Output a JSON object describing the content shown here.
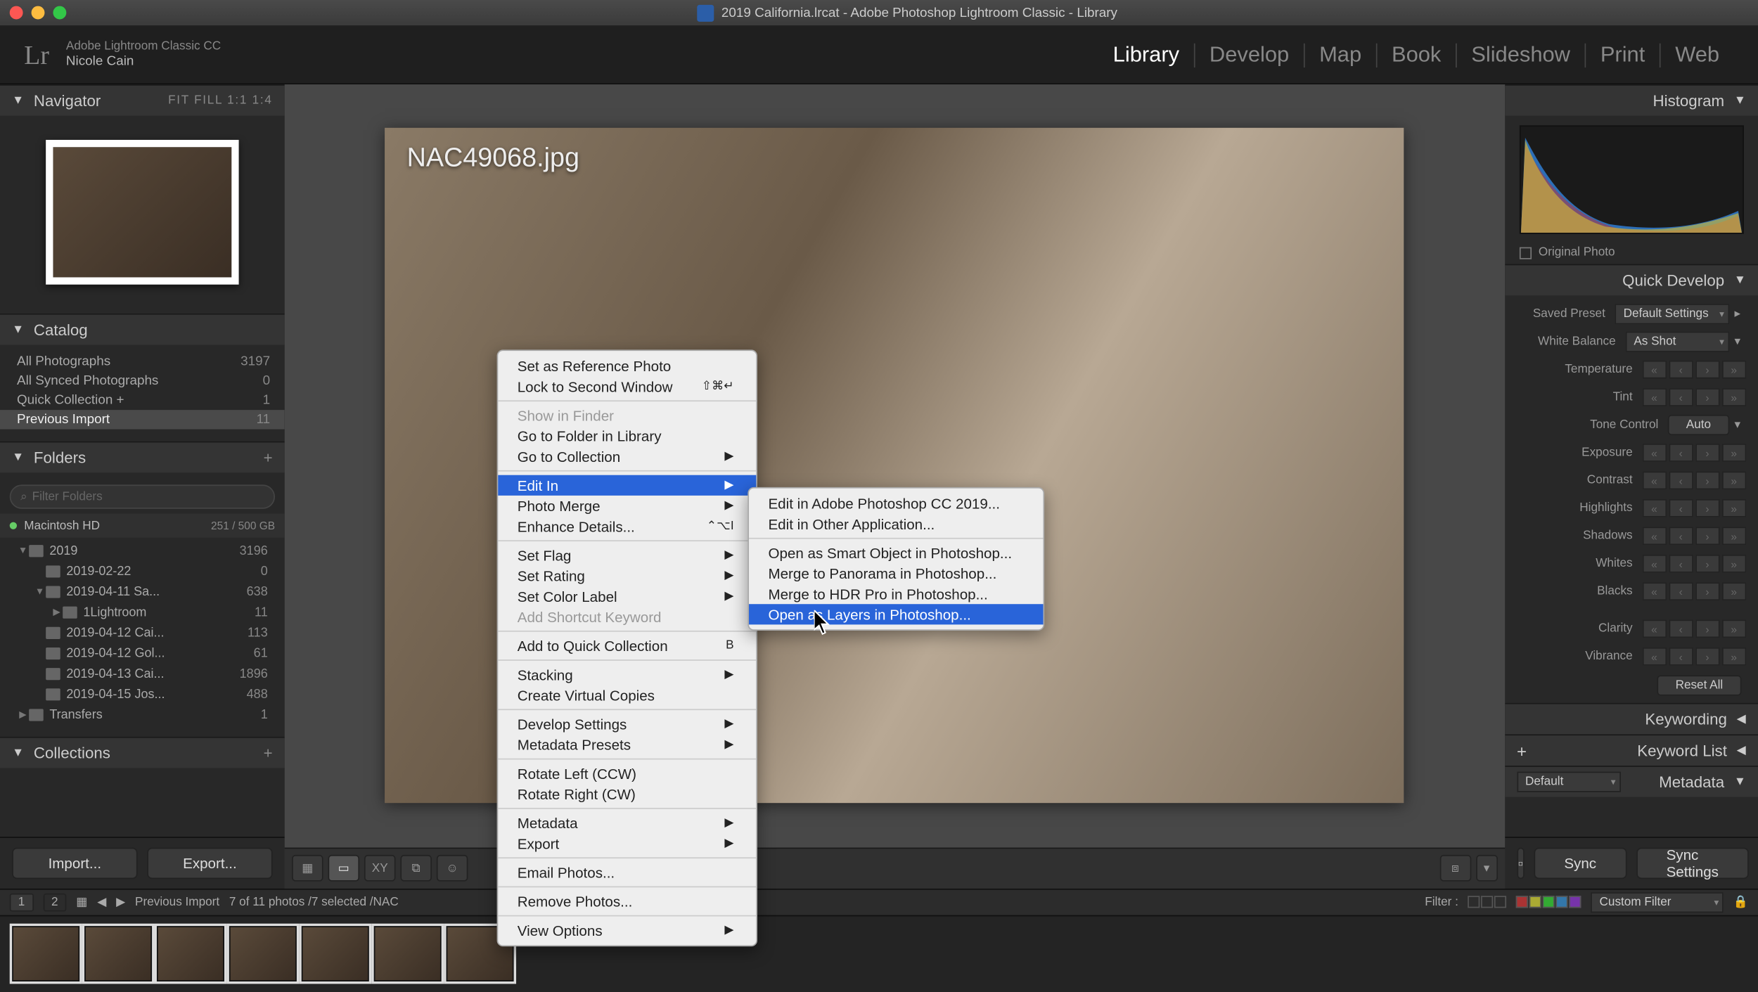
{
  "window": {
    "title": "2019 California.lrcat - Adobe Photoshop Lightroom Classic - Library"
  },
  "identity": {
    "logo": "Lr",
    "product": "Adobe Lightroom Classic CC",
    "user": "Nicole Cain"
  },
  "modules": [
    "Library",
    "Develop",
    "Map",
    "Book",
    "Slideshow",
    "Print",
    "Web"
  ],
  "active_module": "Library",
  "left": {
    "navigator": {
      "title": "Navigator",
      "zoom_labels": "FIT   FILL   1:1   1:4"
    },
    "catalog": {
      "title": "Catalog",
      "items": [
        {
          "label": "All Photographs",
          "count": "3197"
        },
        {
          "label": "All Synced Photographs",
          "count": "0"
        },
        {
          "label": "Quick Collection  +",
          "count": "1"
        },
        {
          "label": "Previous Import",
          "count": "11",
          "selected": true
        }
      ]
    },
    "folders": {
      "title": "Folders",
      "filter_placeholder": "Filter Folders",
      "volume": {
        "name": "Macintosh HD",
        "free": "251 / 500 GB"
      },
      "tree": [
        {
          "indent": 0,
          "tri": "▼",
          "name": "2019",
          "count": "3196"
        },
        {
          "indent": 1,
          "tri": "",
          "name": "2019-02-22",
          "count": "0"
        },
        {
          "indent": 1,
          "tri": "▼",
          "name": "2019-04-11 Sa...",
          "count": "638"
        },
        {
          "indent": 2,
          "tri": "▶",
          "name": "1Lightroom",
          "count": "11"
        },
        {
          "indent": 1,
          "tri": "",
          "name": "2019-04-12 Cai...",
          "count": "113"
        },
        {
          "indent": 1,
          "tri": "",
          "name": "2019-04-12 Gol...",
          "count": "61"
        },
        {
          "indent": 1,
          "tri": "",
          "name": "2019-04-13 Cai...",
          "count": "1896"
        },
        {
          "indent": 1,
          "tri": "",
          "name": "2019-04-15 Jos...",
          "count": "488"
        },
        {
          "indent": 0,
          "tri": "▶",
          "name": "Transfers",
          "count": "1"
        }
      ]
    },
    "collections_title": "Collections",
    "import_btn": "Import...",
    "export_btn": "Export..."
  },
  "center": {
    "filename": "NAC49068.jpg"
  },
  "context_menu": {
    "items": [
      {
        "label": "Set as Reference Photo"
      },
      {
        "label": "Lock to Second Window",
        "shortcut": "⇧⌘↵"
      },
      {
        "sep": true
      },
      {
        "label": "Show in Finder",
        "disabled": true
      },
      {
        "label": "Go to Folder in Library"
      },
      {
        "label": "Go to Collection",
        "submenu": true
      },
      {
        "sep": true
      },
      {
        "label": "Edit In",
        "submenu": true,
        "selected": true
      },
      {
        "label": "Photo Merge",
        "submenu": true
      },
      {
        "label": "Enhance Details...",
        "shortcut": "⌃⌥I"
      },
      {
        "sep": true
      },
      {
        "label": "Set Flag",
        "submenu": true
      },
      {
        "label": "Set Rating",
        "submenu": true
      },
      {
        "label": "Set Color Label",
        "submenu": true
      },
      {
        "label": "Add Shortcut Keyword",
        "disabled": true
      },
      {
        "sep": true
      },
      {
        "label": "Add to Quick Collection",
        "shortcut": "B"
      },
      {
        "sep": true
      },
      {
        "label": "Stacking",
        "submenu": true
      },
      {
        "label": "Create Virtual Copies"
      },
      {
        "sep": true
      },
      {
        "label": "Develop Settings",
        "submenu": true
      },
      {
        "label": "Metadata Presets",
        "submenu": true
      },
      {
        "sep": true
      },
      {
        "label": "Rotate Left (CCW)"
      },
      {
        "label": "Rotate Right (CW)"
      },
      {
        "sep": true
      },
      {
        "label": "Metadata",
        "submenu": true
      },
      {
        "label": "Export",
        "submenu": true
      },
      {
        "sep": true
      },
      {
        "label": "Email Photos..."
      },
      {
        "sep": true
      },
      {
        "label": "Remove Photos..."
      },
      {
        "sep": true
      },
      {
        "label": "View Options",
        "submenu": true
      }
    ],
    "submenu": [
      {
        "label": "Edit in Adobe Photoshop CC 2019..."
      },
      {
        "label": "Edit in Other Application..."
      },
      {
        "sep": true
      },
      {
        "label": "Open as Smart Object in Photoshop..."
      },
      {
        "label": "Merge to Panorama in Photoshop..."
      },
      {
        "label": "Merge to HDR Pro in Photoshop..."
      },
      {
        "label": "Open as Layers in Photoshop...",
        "selected": true
      }
    ]
  },
  "right": {
    "histogram_title": "Histogram",
    "original_photo": "Original Photo",
    "quick_develop": {
      "title": "Quick Develop",
      "saved_preset_label": "Saved Preset",
      "saved_preset": "Default Settings",
      "wb_label": "White Balance",
      "wb_value": "As Shot",
      "temperature": "Temperature",
      "tint": "Tint",
      "tone_label": "Tone Control",
      "auto": "Auto",
      "sliders": [
        "Exposure",
        "Contrast",
        "Highlights",
        "Shadows",
        "Whites",
        "Blacks",
        "Clarity",
        "Vibrance"
      ],
      "reset": "Reset All"
    },
    "keywording": "Keywording",
    "keyword_list": "Keyword List",
    "metadata": "Metadata",
    "metadata_preset": "Default",
    "sync": "Sync",
    "sync_settings": "Sync Settings"
  },
  "infobar": {
    "screens": [
      "1",
      "2"
    ],
    "source": "Previous Import",
    "counts": "7 of 11 photos /7 selected /NAC",
    "filter_label": "Filter :",
    "custom_filter": "Custom Filter"
  }
}
